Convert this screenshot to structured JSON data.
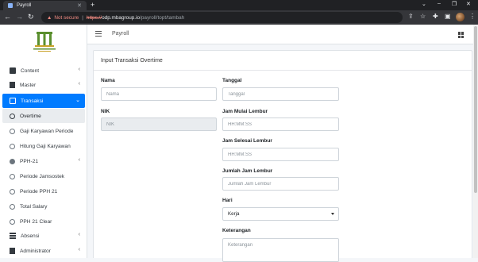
{
  "browser": {
    "tab_title": "Payroll",
    "security_label": "Not secure",
    "url_scheme": "https://",
    "url_host": "odp.mbagroup.io",
    "url_path": "/payroll/topt/tambah"
  },
  "topbar": {
    "title": "Payroll"
  },
  "sidebar": {
    "items": [
      {
        "label": "Content",
        "icon": "copy-icon"
      },
      {
        "label": "Master",
        "icon": "file-icon"
      },
      {
        "label": "Transaksi",
        "icon": "edit-icon",
        "active": true
      },
      {
        "label": "Overtime",
        "selected": true
      },
      {
        "label": "Gaji Karyawan Periode"
      },
      {
        "label": "Hitung Gaji Karyawan"
      },
      {
        "label": "PPH-21"
      },
      {
        "label": "Periode Jamsostek"
      },
      {
        "label": "Periode PPH 21"
      },
      {
        "label": "Total Salary"
      },
      {
        "label": "PPH 21 Clear"
      },
      {
        "label": "Absensi",
        "icon": "table-icon"
      },
      {
        "label": "Administrator",
        "icon": "book-icon"
      }
    ]
  },
  "form": {
    "title": "Input Transaksi Overtime",
    "nama": {
      "label": "Nama",
      "placeholder": "Nama"
    },
    "nik": {
      "label": "NIK",
      "placeholder": "NIK"
    },
    "tanggal": {
      "label": "Tanggal",
      "placeholder": "Tanggal"
    },
    "jam_mulai": {
      "label": "Jam Mulai Lembur",
      "placeholder": "HH:MM:SS"
    },
    "jam_selesai": {
      "label": "Jam Selesai Lembur",
      "placeholder": "HH:MM:SS"
    },
    "jumlah_jam": {
      "label": "Jumlah Jam Lembur",
      "placeholder": "Jumlah Jam Lembur"
    },
    "hari": {
      "label": "Hari",
      "value": "Kerja"
    },
    "keterangan": {
      "label": "Keterangan",
      "placeholder": "Keterangan"
    }
  },
  "colors": {
    "active": "#007bff",
    "sidebar_bg": "#ffffff",
    "page_bg": "#f4f6f9"
  }
}
